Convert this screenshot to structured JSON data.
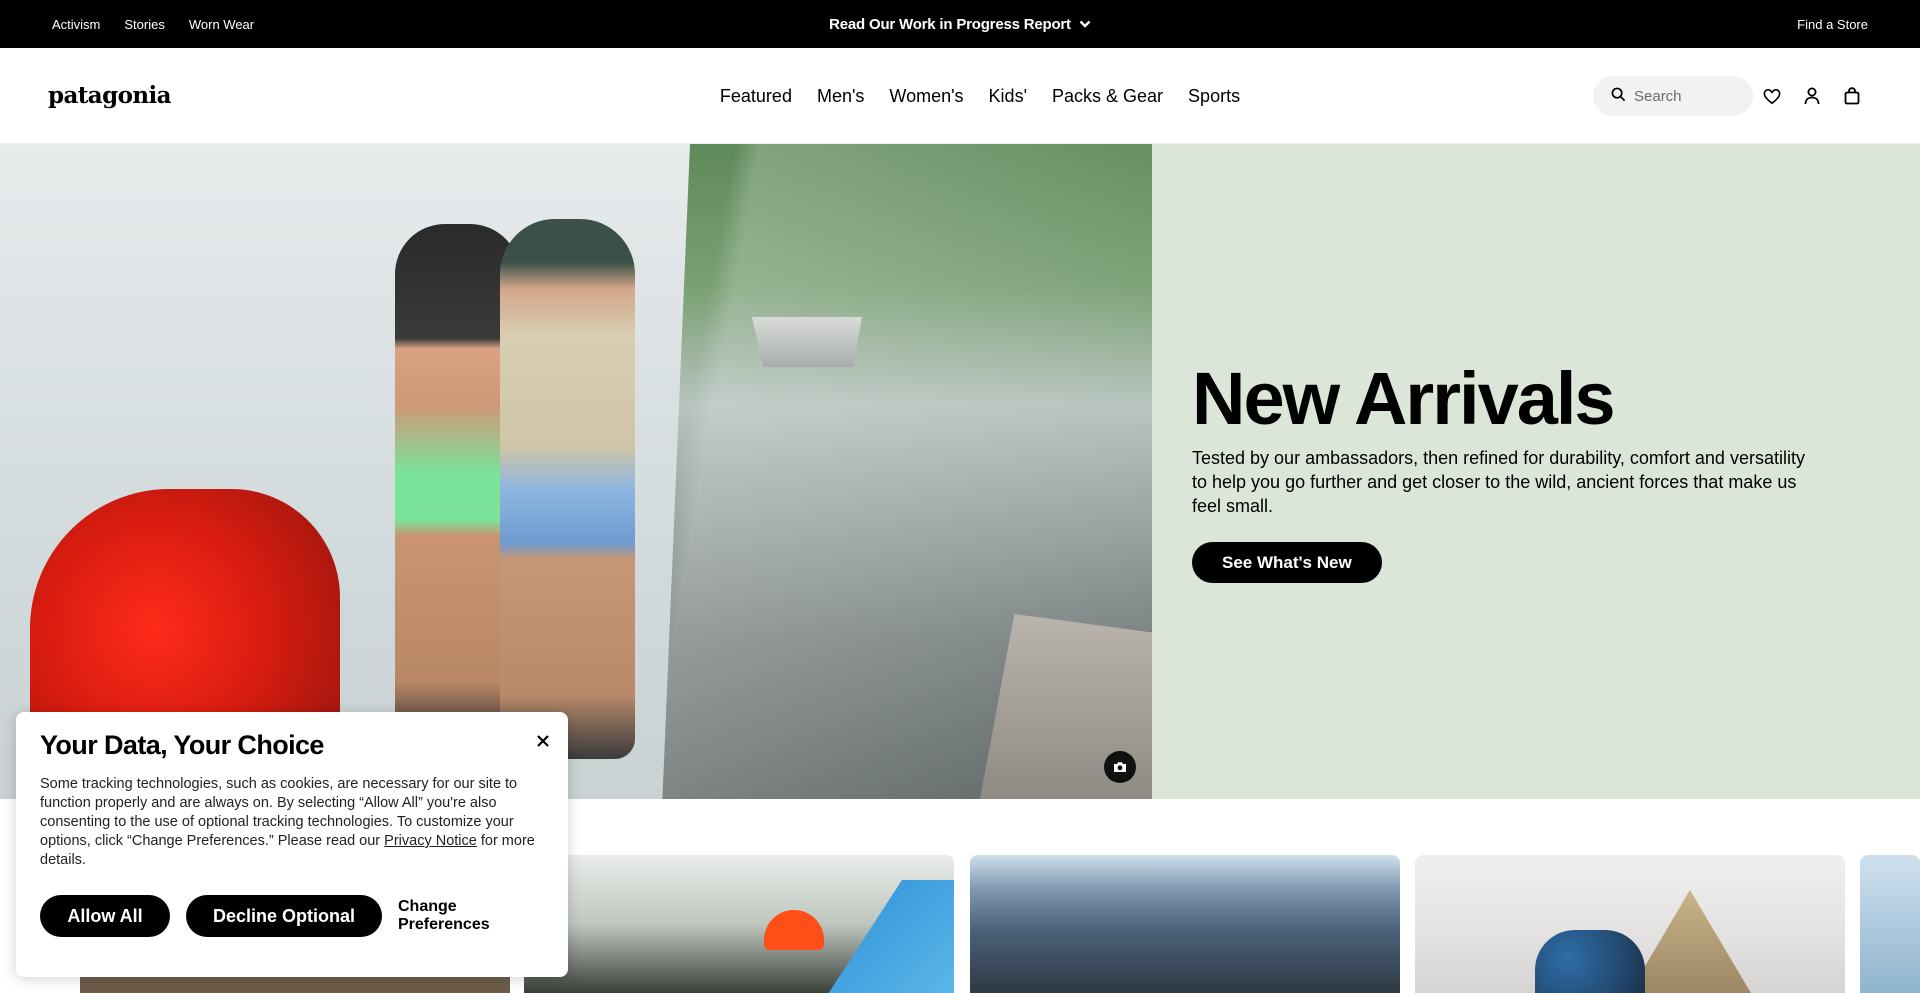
{
  "utility_bar": {
    "links": [
      "Activism",
      "Stories",
      "Worn Wear"
    ],
    "promo": "Read Our Work in Progress Report",
    "find_store": "Find a Store"
  },
  "header": {
    "logo": "patagonia",
    "nav": [
      "Featured",
      "Men's",
      "Women's",
      "Kids'",
      "Packs & Gear",
      "Sports"
    ],
    "search_placeholder": "Search",
    "icons": [
      "heart-icon",
      "account-icon",
      "bag-icon"
    ]
  },
  "hero": {
    "title": "New Arrivals",
    "description": "Tested by our ambassadors, then refined for durability, comfort and versatility to help you go further and get closer to the wild, ancient forces that make us feel small.",
    "cta": "See What's New",
    "panel_color": "#dbe6d8"
  },
  "cookie_dialog": {
    "title": "Your Data, Your Choice",
    "body_before": "Some tracking technologies, such as cookies, are necessary for our site to function properly and are always on. By selecting “Allow All” you're also consenting to the use of optional tracking technologies. To customize your options, click “Change Preferences.” Please read our ",
    "link": "Privacy Notice",
    "body_after": " for more details.",
    "allow_all": "Allow All",
    "decline_optional": "Decline Optional",
    "change_preferences": "Change Preferences"
  }
}
